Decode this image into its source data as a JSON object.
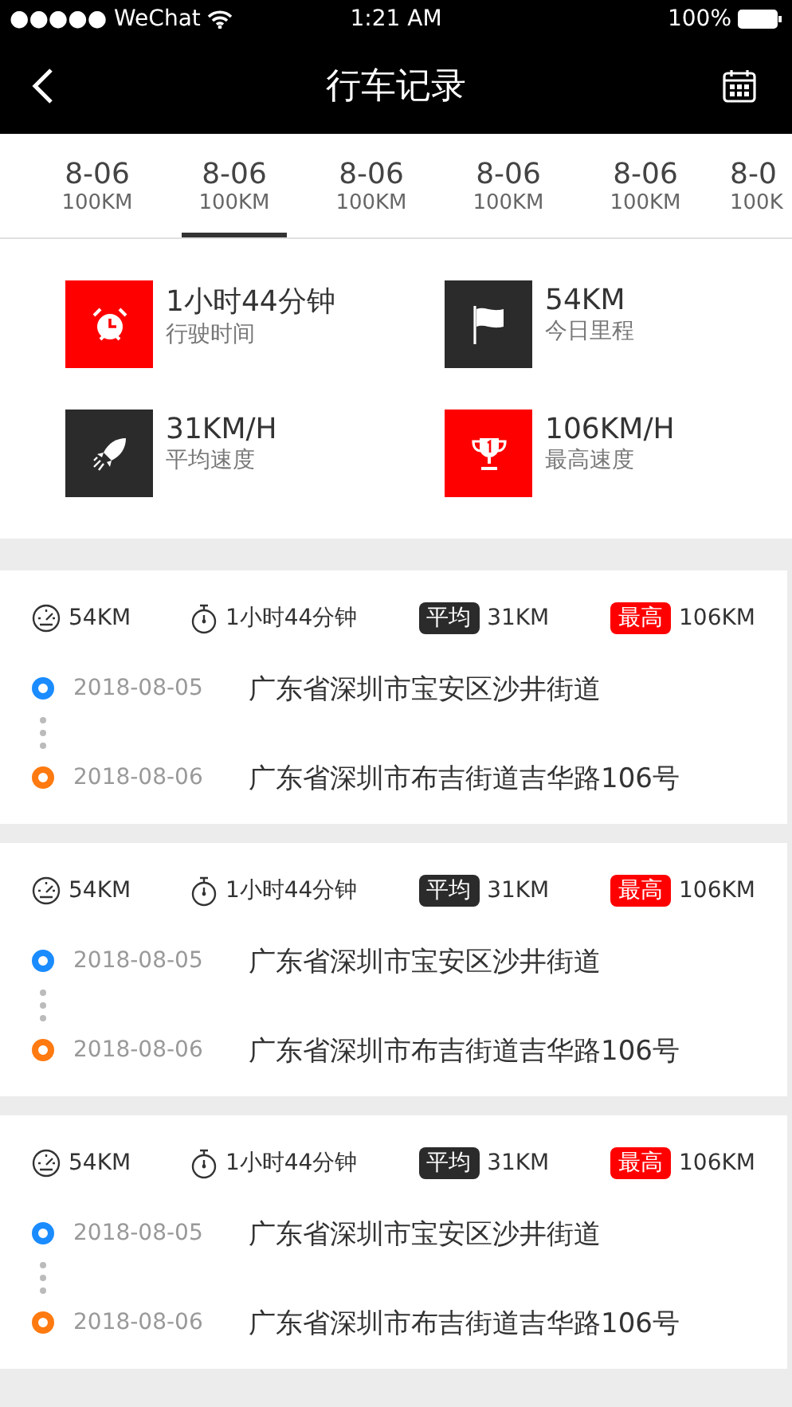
{
  "status_bar": {
    "carrier": "●●●●● WeChat",
    "time": "1:21 AM",
    "battery": "100%"
  },
  "nav": {
    "title": "行车记录"
  },
  "tabs": [
    {
      "date": "8-06",
      "distance": "100KM",
      "selected": false
    },
    {
      "date": "8-06",
      "distance": "100KM",
      "selected": true
    },
    {
      "date": "8-06",
      "distance": "100KM",
      "selected": false
    },
    {
      "date": "8-06",
      "distance": "100KM",
      "selected": false
    },
    {
      "date": "8-06",
      "distance": "100KM",
      "selected": false
    },
    {
      "date": "8-0",
      "distance": "100K",
      "selected": false
    }
  ],
  "summary": [
    {
      "kind": "clock",
      "color": "#ff0000",
      "value": "1小时44分钟",
      "label": "行驶时间"
    },
    {
      "kind": "flag",
      "color": "#2b2b2b",
      "value": "54KM",
      "label": "今日里程"
    },
    {
      "kind": "rocket",
      "color": "#2b2b2b",
      "value": "31KM/H",
      "label": "平均速度"
    },
    {
      "kind": "trophy",
      "color": "#ff0000",
      "value": "106KM/H",
      "label": "最高速度"
    }
  ],
  "trips": [
    {
      "distance": "54KM",
      "duration": "1小时44分钟",
      "avg_label": "平均",
      "avg": "31KM",
      "max_label": "最高",
      "max": "106KM",
      "stops": [
        {
          "kind": "start",
          "date": "2018-08-05",
          "place": "广东省深圳市宝安区沙井街道"
        },
        {
          "kind": "end",
          "date": "2018-08-06",
          "place": "广东省深圳市布吉街道吉华路106号"
        }
      ]
    },
    {
      "distance": "54KM",
      "duration": "1小时44分钟",
      "avg_label": "平均",
      "avg": "31KM",
      "max_label": "最高",
      "max": "106KM",
      "stops": [
        {
          "kind": "start",
          "date": "2018-08-05",
          "place": "广东省深圳市宝安区沙井街道"
        },
        {
          "kind": "end",
          "date": "2018-08-06",
          "place": "广东省深圳市布吉街道吉华路106号"
        }
      ]
    },
    {
      "distance": "54KM",
      "duration": "1小时44分钟",
      "avg_label": "平均",
      "avg": "31KM",
      "max_label": "最高",
      "max": "106KM",
      "stops": [
        {
          "kind": "start",
          "date": "2018-08-05",
          "place": "广东省深圳市宝安区沙井街道"
        },
        {
          "kind": "end",
          "date": "2018-08-06",
          "place": "广东省深圳市布吉街道吉华路106号"
        }
      ]
    }
  ]
}
